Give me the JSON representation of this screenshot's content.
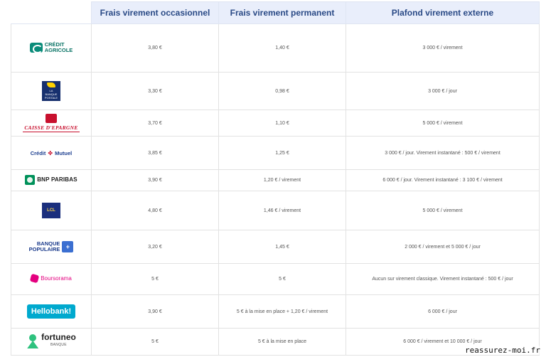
{
  "table": {
    "headers": [
      "",
      "Frais virement occasionnel",
      "Frais virement permanent",
      "Plafond virement externe"
    ],
    "rows": [
      {
        "bank": "Crédit Agricole",
        "logo_line1": "CRÉDIT",
        "logo_line2": "AGRICOLE",
        "occasional": "3,80 €",
        "permanent": "1,40 €",
        "ceiling": "3 000 € / virement"
      },
      {
        "bank": "La Banque Postale",
        "logo_line1": "LA",
        "logo_line2": "BANQUE POSTALE",
        "occasional": "3,30 €",
        "permanent": "0,98 €",
        "ceiling": "3 000 € / jour"
      },
      {
        "bank": "Caisse d'Epargne",
        "logo_line1": "CAISSE D'EPARGNE",
        "occasional": "3,70 €",
        "permanent": "1,10 €",
        "ceiling": "5 000 € / virement"
      },
      {
        "bank": "Crédit Mutuel",
        "logo_line1": "Crédit",
        "logo_line2": "Mutuel",
        "occasional": "3,85 €",
        "permanent": "1,25 €",
        "ceiling": "3 000 € / jour. Virement instantané : 500 € / virement"
      },
      {
        "bank": "BNP Paribas",
        "logo_line1": "BNP PARIBAS",
        "occasional": "3,90 €",
        "permanent": "1,20 € / virement",
        "ceiling": "6 000 € / jour. Virement instantané : 3 100 € / virement"
      },
      {
        "bank": "LCL",
        "logo_line1": "LCL",
        "occasional": "4,80 €",
        "permanent": "1,46 € / virement",
        "ceiling": "5 000 € / virement"
      },
      {
        "bank": "Banque Populaire",
        "logo_line1": "BANQUE",
        "logo_line2": "POPULAIRE",
        "occasional": "3,20 €",
        "permanent": "1,45 €",
        "ceiling": "2 000 € / virement et 5 000 € / jour"
      },
      {
        "bank": "Boursorama",
        "logo_line1": "Boursorama",
        "occasional": "5 €",
        "permanent": "5 €",
        "ceiling": "Aucun sur virement classique. Virement instantané : 500 € / jour"
      },
      {
        "bank": "Hello bank!",
        "logo_line1": "Hellobank!",
        "occasional": "3,90 €",
        "permanent": "5 € à la mise en place + 1,20 € / virement",
        "ceiling": "6 000 € / jour"
      },
      {
        "bank": "Fortuneo",
        "logo_line1": "fortuneo",
        "logo_line2": "BANQUE",
        "occasional": "5 €",
        "permanent": "5 € à la mise en place",
        "ceiling": "6 000 € / virement et 10 000 € / jour"
      }
    ]
  },
  "watermark": "reassurez-moi.fr",
  "colors": {
    "header_bg": "#e9eefb",
    "header_text": "#2a4a86",
    "grid": "#e2e2e2"
  }
}
